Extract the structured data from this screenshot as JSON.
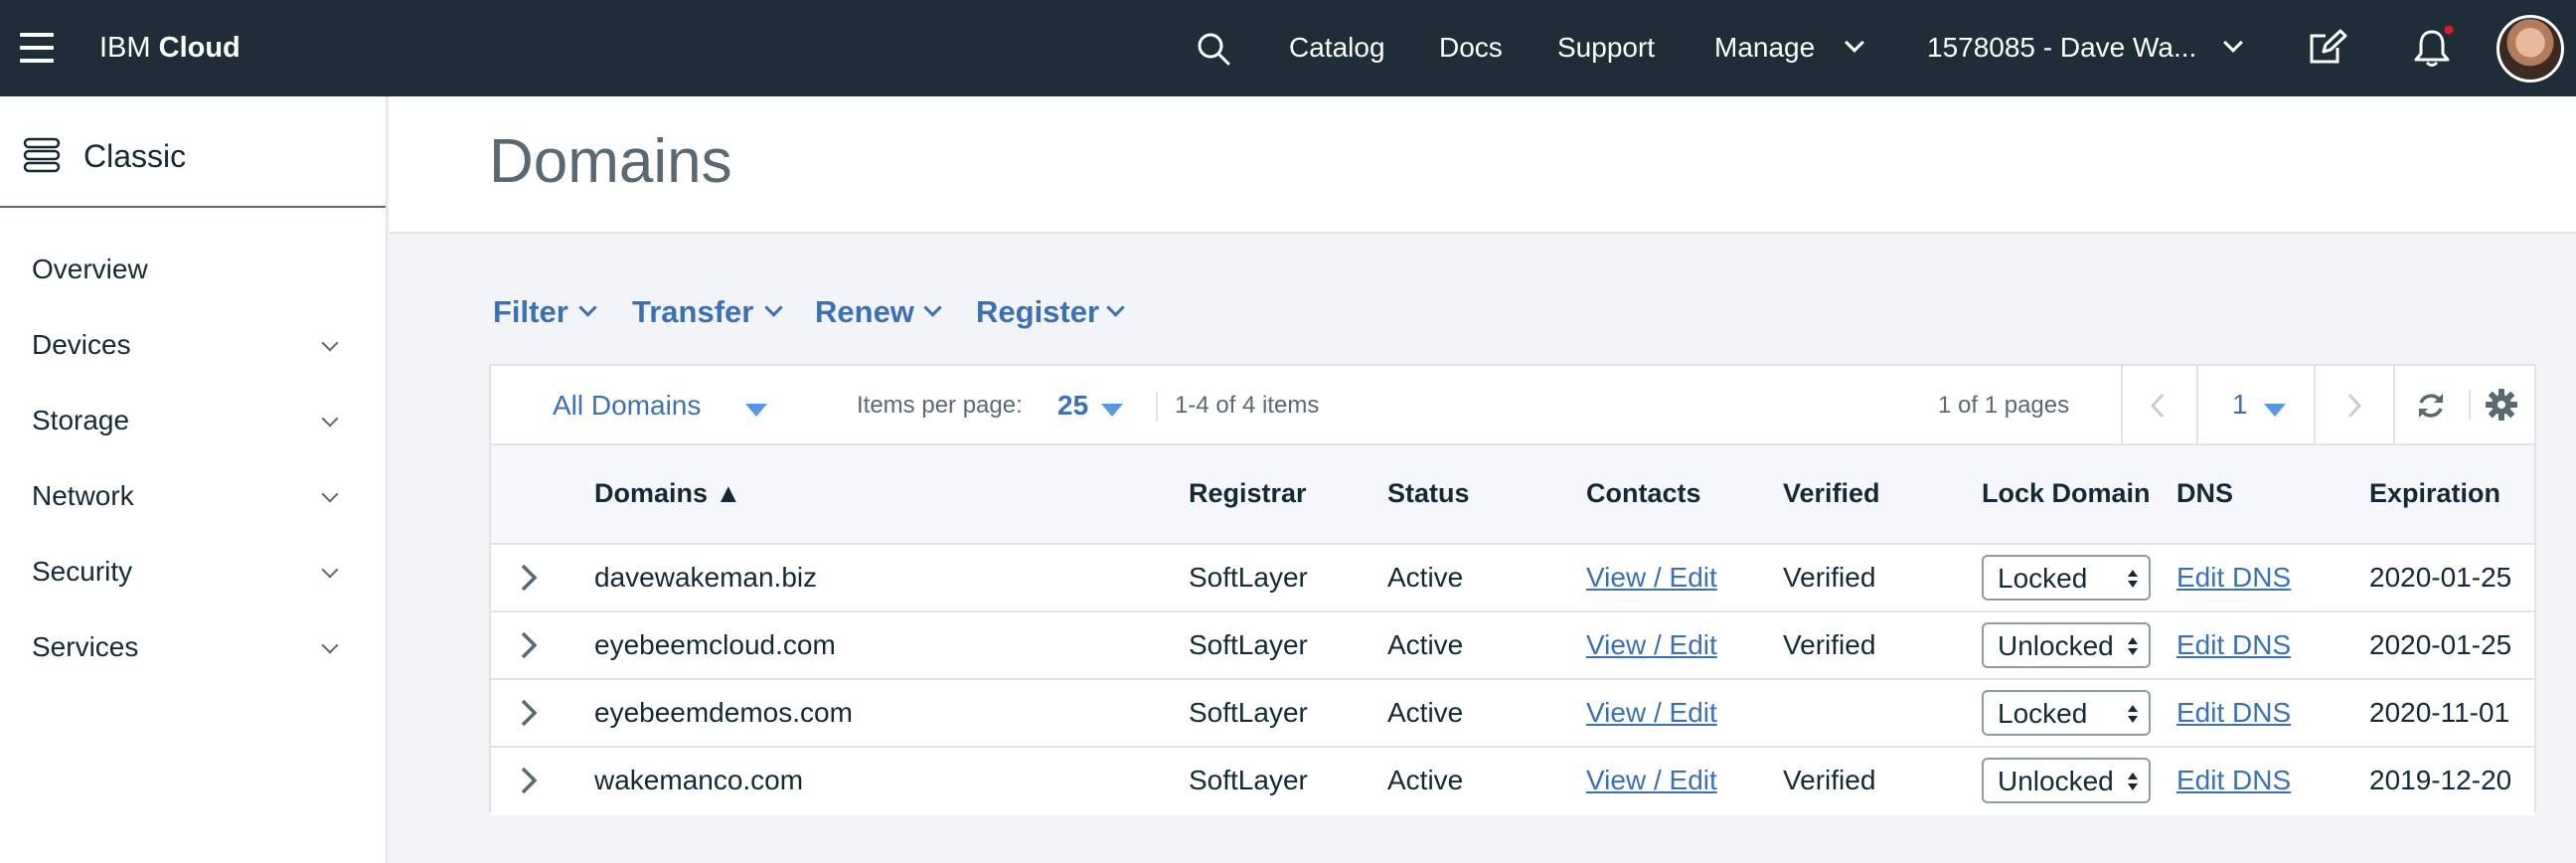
{
  "header": {
    "brand_light": "IBM",
    "brand_bold": "Cloud",
    "nav": [
      "Catalog",
      "Docs",
      "Support",
      "Manage"
    ],
    "account": "1578085 - Dave Wa..."
  },
  "sidebar": {
    "title": "Classic",
    "items": [
      {
        "label": "Overview",
        "has_chevron": false
      },
      {
        "label": "Devices",
        "has_chevron": true
      },
      {
        "label": "Storage",
        "has_chevron": true
      },
      {
        "label": "Network",
        "has_chevron": true
      },
      {
        "label": "Security",
        "has_chevron": true
      },
      {
        "label": "Services",
        "has_chevron": true
      }
    ]
  },
  "page": {
    "title": "Domains"
  },
  "actions": [
    "Filter",
    "Transfer",
    "Renew",
    "Register"
  ],
  "toolbar": {
    "scope": "All Domains",
    "items_per_page_label": "Items per page:",
    "items_per_page": "25",
    "item_range": "1-4 of 4 items",
    "page_count": "1 of 1 pages",
    "current_page": "1"
  },
  "table": {
    "columns": [
      "Domains ▲",
      "Registrar",
      "Status",
      "Contacts",
      "Verified",
      "Lock Domain",
      "DNS",
      "Expiration"
    ],
    "rows": [
      {
        "domain": "davewakeman.biz",
        "registrar": "SoftLayer",
        "status": "Active",
        "contacts": "View / Edit",
        "verified": "Verified",
        "lock": "Locked",
        "dns": "Edit DNS",
        "expiration": "2020-01-25"
      },
      {
        "domain": "eyebeemcloud.com",
        "registrar": "SoftLayer",
        "status": "Active",
        "contacts": "View / Edit",
        "verified": "Verified",
        "lock": "Unlocked",
        "dns": "Edit DNS",
        "expiration": "2020-01-25"
      },
      {
        "domain": "eyebeemdemos.com",
        "registrar": "SoftLayer",
        "status": "Active",
        "contacts": "View / Edit",
        "verified": "",
        "lock": "Locked",
        "dns": "Edit DNS",
        "expiration": "2020-11-01"
      },
      {
        "domain": "wakemanco.com",
        "registrar": "SoftLayer",
        "status": "Active",
        "contacts": "View / Edit",
        "verified": "Verified",
        "lock": "Unlocked",
        "dns": "Edit DNS",
        "expiration": "2019-12-20"
      }
    ]
  },
  "icons": {
    "menu": "hamburger-menu-icon",
    "search": "search-icon",
    "edit": "edit-icon",
    "notifications": "bell-icon",
    "classic": "stack-icon",
    "refresh": "refresh-icon",
    "settings": "gear-icon"
  },
  "colors": {
    "header_bg": "#1e2d38",
    "link": "#3d70b2",
    "notification_dot": "#e0182d",
    "page_bg": "#f3f4f8"
  }
}
